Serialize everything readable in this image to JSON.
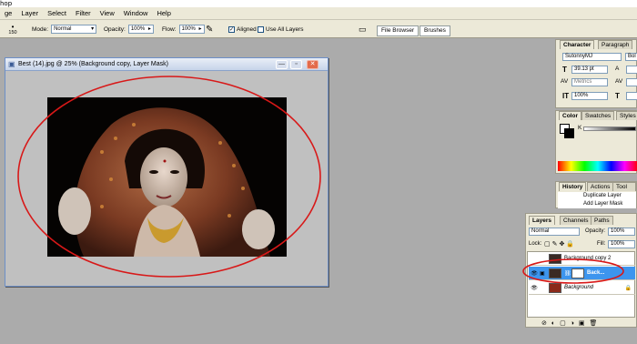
{
  "app_title_fragment": "hop",
  "menu": [
    "ge",
    "Layer",
    "Select",
    "Filter",
    "View",
    "Window",
    "Help"
  ],
  "options": {
    "brush_size": "150",
    "mode_label": "Mode:",
    "mode_value": "Normal",
    "opacity_label": "Opacity:",
    "opacity_value": "100%",
    "flow_label": "Flow:",
    "flow_value": "100%",
    "aligned_label": "Aligned",
    "aligned_checked": true,
    "use_all_layers_label": "Use All Layers",
    "use_all_layers_checked": false
  },
  "palette_well": {
    "file_browser": "File Browser",
    "brushes": "Brushes"
  },
  "document": {
    "title": "Best (14).jpg @ 25% (Background copy, Layer Mask)",
    "minimize": "—",
    "restore": "▫",
    "close": "✕"
  },
  "character_panel": {
    "tabs": [
      "Character",
      "Paragraph"
    ],
    "font_family": "SutonnyMJ",
    "font_style": "Bol",
    "font_size": "39.13 pt",
    "tracking": "Metrics",
    "scale": "100%",
    "leading_icon": "A",
    "kerning_icon": "AV"
  },
  "color_panel": {
    "tabs": [
      "Color",
      "Swatches",
      "Styles"
    ],
    "channel": "K"
  },
  "history_panel": {
    "tabs": [
      "History",
      "Actions",
      "Tool Prese"
    ],
    "items": [
      "Duplicate Layer",
      "Add Layer Mask"
    ]
  },
  "layers_panel": {
    "tabs": [
      "Layers",
      "Channels",
      "Paths"
    ],
    "blend_mode": "Normal",
    "opacity_label": "Opacity:",
    "opacity_value": "100%",
    "lock_label": "Lock:",
    "fill_label": "Fill:",
    "fill_value": "100%",
    "layers": [
      {
        "name": "Background copy 2",
        "visible": false,
        "selected": false
      },
      {
        "name": "Back...",
        "visible": true,
        "selected": true
      },
      {
        "name": "Background",
        "visible": true,
        "selected": false,
        "locked": true
      }
    ]
  },
  "colors": {
    "highlight_blue": "#3d95ee",
    "annotation_red": "#d81818"
  }
}
